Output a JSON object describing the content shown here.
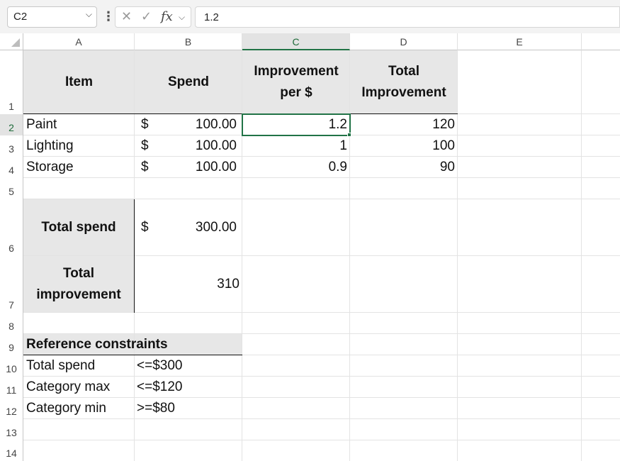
{
  "formula_bar": {
    "name_box": "C2",
    "formula": "1.2"
  },
  "columns": [
    "A",
    "B",
    "C",
    "D",
    "E"
  ],
  "rows": [
    "1",
    "2",
    "3",
    "4",
    "5",
    "6",
    "7",
    "8",
    "9",
    "10",
    "11",
    "12",
    "13",
    "14"
  ],
  "table": {
    "headers": {
      "item": "Item",
      "spend": "Spend",
      "improvement_per": "Improvement per $",
      "total_improvement": "Total Improvement"
    },
    "items": [
      {
        "name": "Paint",
        "currency": "$",
        "spend": "100.00",
        "improvement_per": "1.2",
        "total": "120"
      },
      {
        "name": "Lighting",
        "currency": "$",
        "spend": "100.00",
        "improvement_per": "1",
        "total": "100"
      },
      {
        "name": "Storage",
        "currency": "$",
        "spend": "100.00",
        "improvement_per": "0.9",
        "total": "90"
      }
    ]
  },
  "summary": {
    "total_spend_label": "Total spend",
    "total_spend_currency": "$",
    "total_spend_value": "300.00",
    "total_improvement_label": "Total improvement",
    "total_improvement_value": "310"
  },
  "constraints": {
    "title": "Reference constraints",
    "rows": [
      {
        "label": "Total spend",
        "value": "<=$300"
      },
      {
        "label": "Category max",
        "value": "<=$120"
      },
      {
        "label": "Category min",
        "value": ">=$80"
      }
    ]
  },
  "colors": {
    "selection": "#217346",
    "header_fill": "#e7e7e7"
  }
}
